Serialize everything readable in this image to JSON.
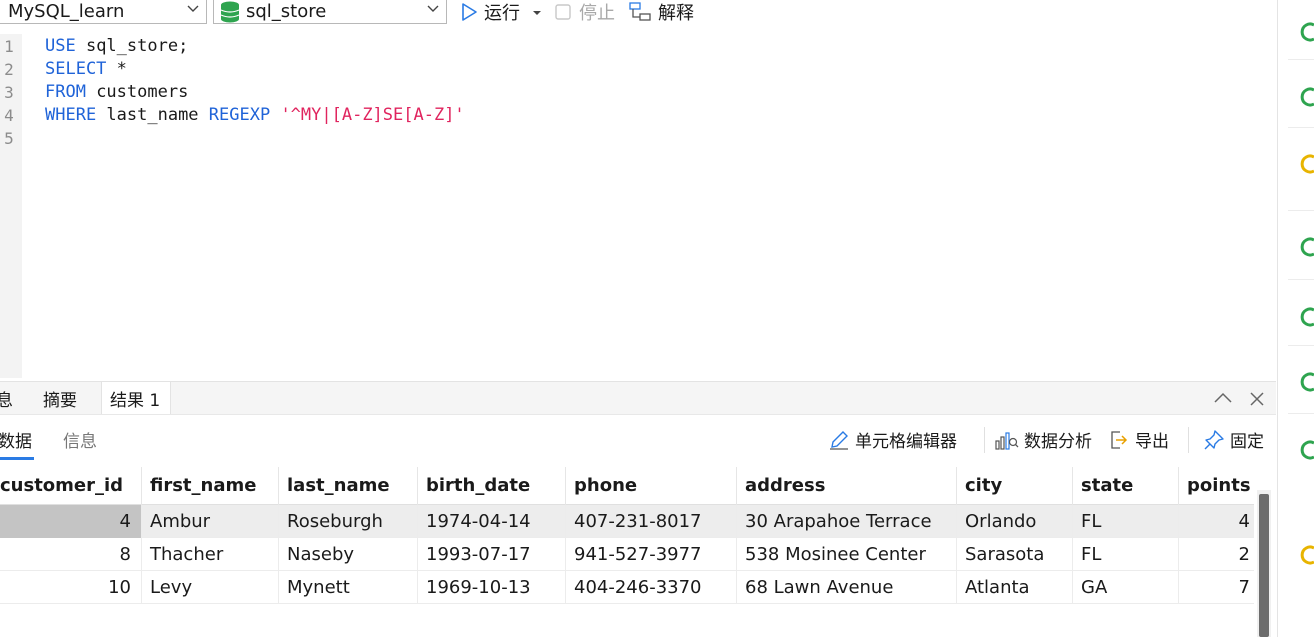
{
  "toolbar": {
    "connection": "MySQL_learn",
    "database": "sql_store",
    "run_label": "运行",
    "stop_label": "停止",
    "explain_label": "解释"
  },
  "editor": {
    "lines": [
      {
        "num": "1",
        "t1": "USE",
        "t2": " sql_store;",
        "t3": "",
        "t4": ""
      },
      {
        "num": "2",
        "t1": "SELECT",
        "t2": " *",
        "t3": "",
        "t4": ""
      },
      {
        "num": "3",
        "t1": "FROM",
        "t2": " customers",
        "t3": "",
        "t4": ""
      },
      {
        "num": "4",
        "t1": "WHERE",
        "t2": " last_name ",
        "t3": "REGEXP",
        "t4": " '^MY|[A-Z]SE[A-Z]'"
      },
      {
        "num": "5",
        "t1": "",
        "t2": "",
        "t3": "",
        "t4": ""
      }
    ]
  },
  "result_tabs": [
    "息",
    "摘要",
    "结果 1"
  ],
  "subtabs": [
    "数据",
    "信息"
  ],
  "actions": {
    "cell_editor": "单元格编辑器",
    "data_analysis": "数据分析",
    "export": "导出",
    "pin": "固定"
  },
  "colors": {
    "keyword": "#1f63d8",
    "string": "#e0245e",
    "accent": "#2a7be4",
    "side_indicator": "#2ea44f",
    "side_indicator_warn": "#e8b400"
  },
  "table": {
    "columns": [
      "customer_id",
      "first_name",
      "last_name",
      "birth_date",
      "phone",
      "address",
      "city",
      "state",
      "points"
    ],
    "rows": [
      [
        "4",
        "Ambur",
        "Roseburgh",
        "1974-04-14",
        "407-231-8017",
        "30 Arapahoe Terrace",
        "Orlando",
        "FL",
        "4"
      ],
      [
        "8",
        "Thacher",
        "Naseby",
        "1993-07-17",
        "941-527-3977",
        "538 Mosinee Center",
        "Sarasota",
        "FL",
        "2"
      ],
      [
        "10",
        "Levy",
        "Mynett",
        "1969-10-13",
        "404-246-3370",
        "68 Lawn Avenue",
        "Atlanta",
        "GA",
        "7"
      ]
    ]
  }
}
